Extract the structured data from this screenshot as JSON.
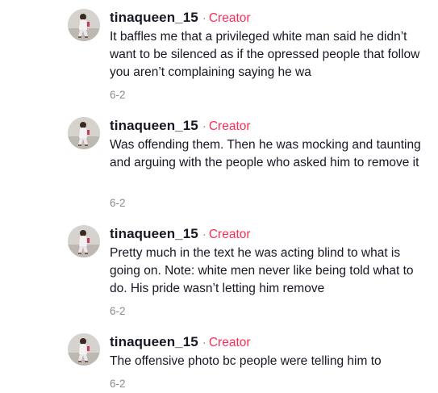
{
  "comments": [
    {
      "username": "tinaqueen_15",
      "separator": "·",
      "badge": "Creator",
      "text": "It baffles me that a privileged white man said he didn’t want to be silenced as if the opressed people that follow you aren’t complaining saying he wa",
      "date": "6-2"
    },
    {
      "username": "tinaqueen_15",
      "separator": "·",
      "badge": "Creator",
      "text": "Was offending them. Then he was mocking and taunting and arguing with the people who asked him to remove it",
      "date": "6-2"
    },
    {
      "username": "tinaqueen_15",
      "separator": "·",
      "badge": "Creator",
      "text": "Pretty much in the text he was acting blind to what is going on. Note: white men never like being told what to do. His pride wasn’t letting him remove",
      "date": "6-2"
    },
    {
      "username": "tinaqueen_15",
      "separator": "·",
      "badge": "Creator",
      "text": "The offensive photo bc people were telling him to",
      "date": "6-2"
    }
  ],
  "colors": {
    "badge": "#fe2c55",
    "meta": "#8a8b91",
    "text": "#161823"
  },
  "icons": {
    "avatar": "user-avatar-icon"
  }
}
